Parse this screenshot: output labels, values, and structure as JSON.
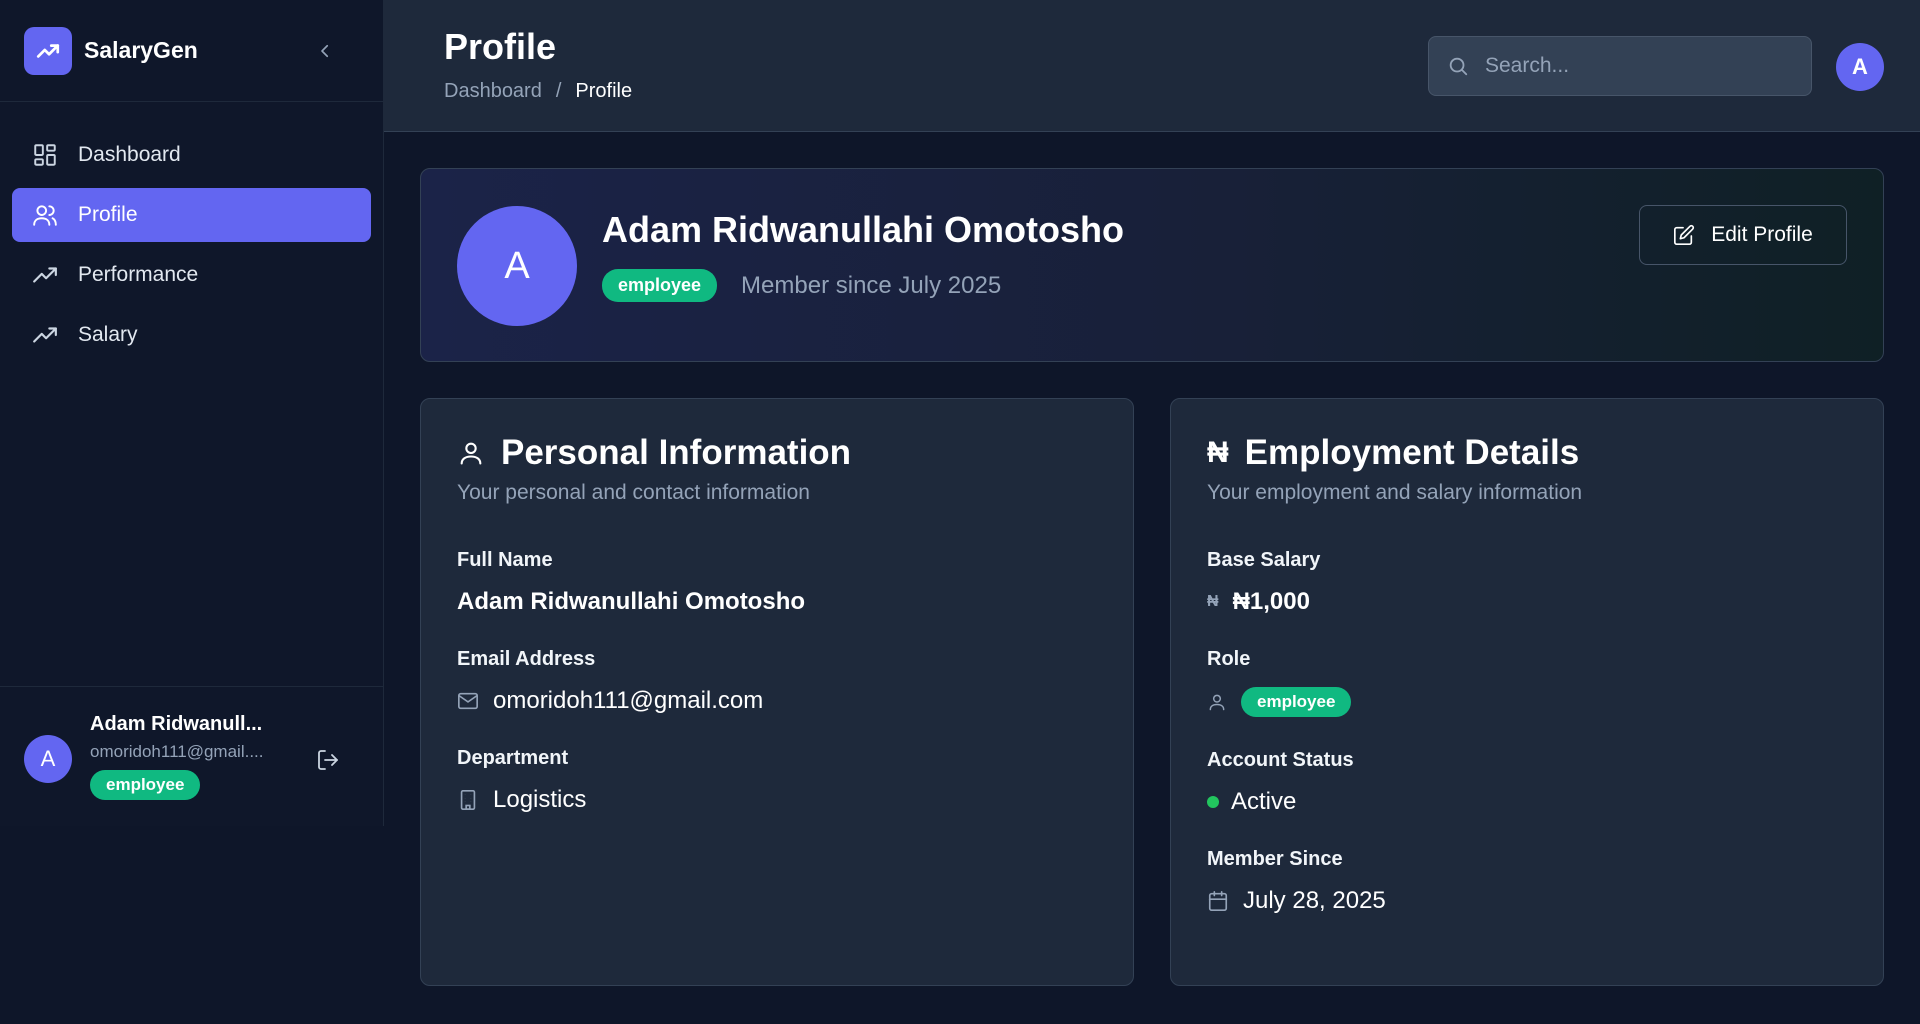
{
  "brand": {
    "name": "SalaryGen"
  },
  "nav": {
    "items": [
      {
        "label": "Dashboard",
        "icon": "dashboard-icon",
        "active": false
      },
      {
        "label": "Profile",
        "icon": "users-icon",
        "active": true
      },
      {
        "label": "Performance",
        "icon": "trending-up-icon",
        "active": false
      },
      {
        "label": "Salary",
        "icon": "trending-up-icon",
        "active": false
      }
    ]
  },
  "sidebar_user": {
    "avatar_initial": "A",
    "name": "Adam Ridwanull...",
    "email": "omoridoh111@gmail....",
    "role": "employee"
  },
  "header": {
    "title": "Profile",
    "breadcrumb": {
      "parent": "Dashboard",
      "separator": "/",
      "current": "Profile"
    },
    "search_placeholder": "Search...",
    "avatar_initial": "A"
  },
  "profile": {
    "avatar_initial": "A",
    "name": "Adam Ridwanullahi Omotosho",
    "role": "employee",
    "member_since": "Member since July 2025",
    "edit_label": "Edit Profile"
  },
  "personal": {
    "title": "Personal Information",
    "subtitle": "Your personal and contact information",
    "full_name_label": "Full Name",
    "full_name": "Adam Ridwanullahi Omotosho",
    "email_label": "Email Address",
    "email": "omoridoh111@gmail.com",
    "department_label": "Department",
    "department": "Logistics"
  },
  "employment": {
    "title_symbol": "₦",
    "title": "Employment Details",
    "subtitle": "Your employment and salary information",
    "base_salary_label": "Base Salary",
    "currency_symbol": "₦",
    "base_salary": "₦1,000",
    "role_label": "Role",
    "role": "employee",
    "status_label": "Account Status",
    "status": "Active",
    "member_since_label": "Member Since",
    "member_since": "July 28, 2025"
  },
  "colors": {
    "accent": "#6366f1",
    "success": "#10b981",
    "active_dot": "#22c55e",
    "background": "#0e1629",
    "card": "#1e293b"
  }
}
